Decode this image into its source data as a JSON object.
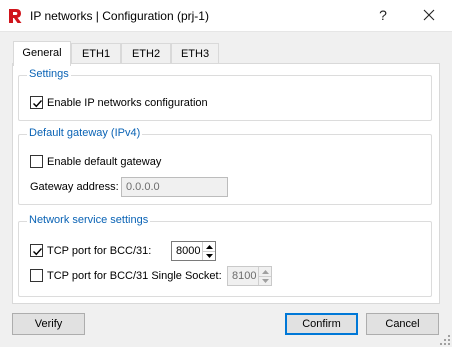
{
  "window": {
    "title": "IP networks | Configuration (prj-1)",
    "help_label": "?",
    "app_icon": "r-logo-icon",
    "accent": "#0078d7",
    "legend_color": "#0a63b5"
  },
  "tabs": [
    {
      "label": "General",
      "active": true
    },
    {
      "label": "ETH1",
      "active": false
    },
    {
      "label": "ETH2",
      "active": false
    },
    {
      "label": "ETH3",
      "active": false
    }
  ],
  "settings": {
    "legend": "Settings",
    "enable_ip_label": "Enable IP networks configuration",
    "enable_ip_checked": true
  },
  "gateway": {
    "legend": "Default gateway (IPv4)",
    "enable_label": "Enable default gateway",
    "enable_checked": false,
    "address_label": "Gateway address:",
    "address_value": "0.0.0.0"
  },
  "network_service": {
    "legend": "Network service settings",
    "tcp_label": "TCP port for BCC/31:",
    "tcp_checked": true,
    "tcp_value": "8000",
    "tcp_single_label": "TCP port for BCC/31 Single Socket:",
    "tcp_single_checked": false,
    "tcp_single_value": "8100"
  },
  "buttons": {
    "verify": "Verify",
    "confirm": "Confirm",
    "cancel": "Cancel"
  }
}
